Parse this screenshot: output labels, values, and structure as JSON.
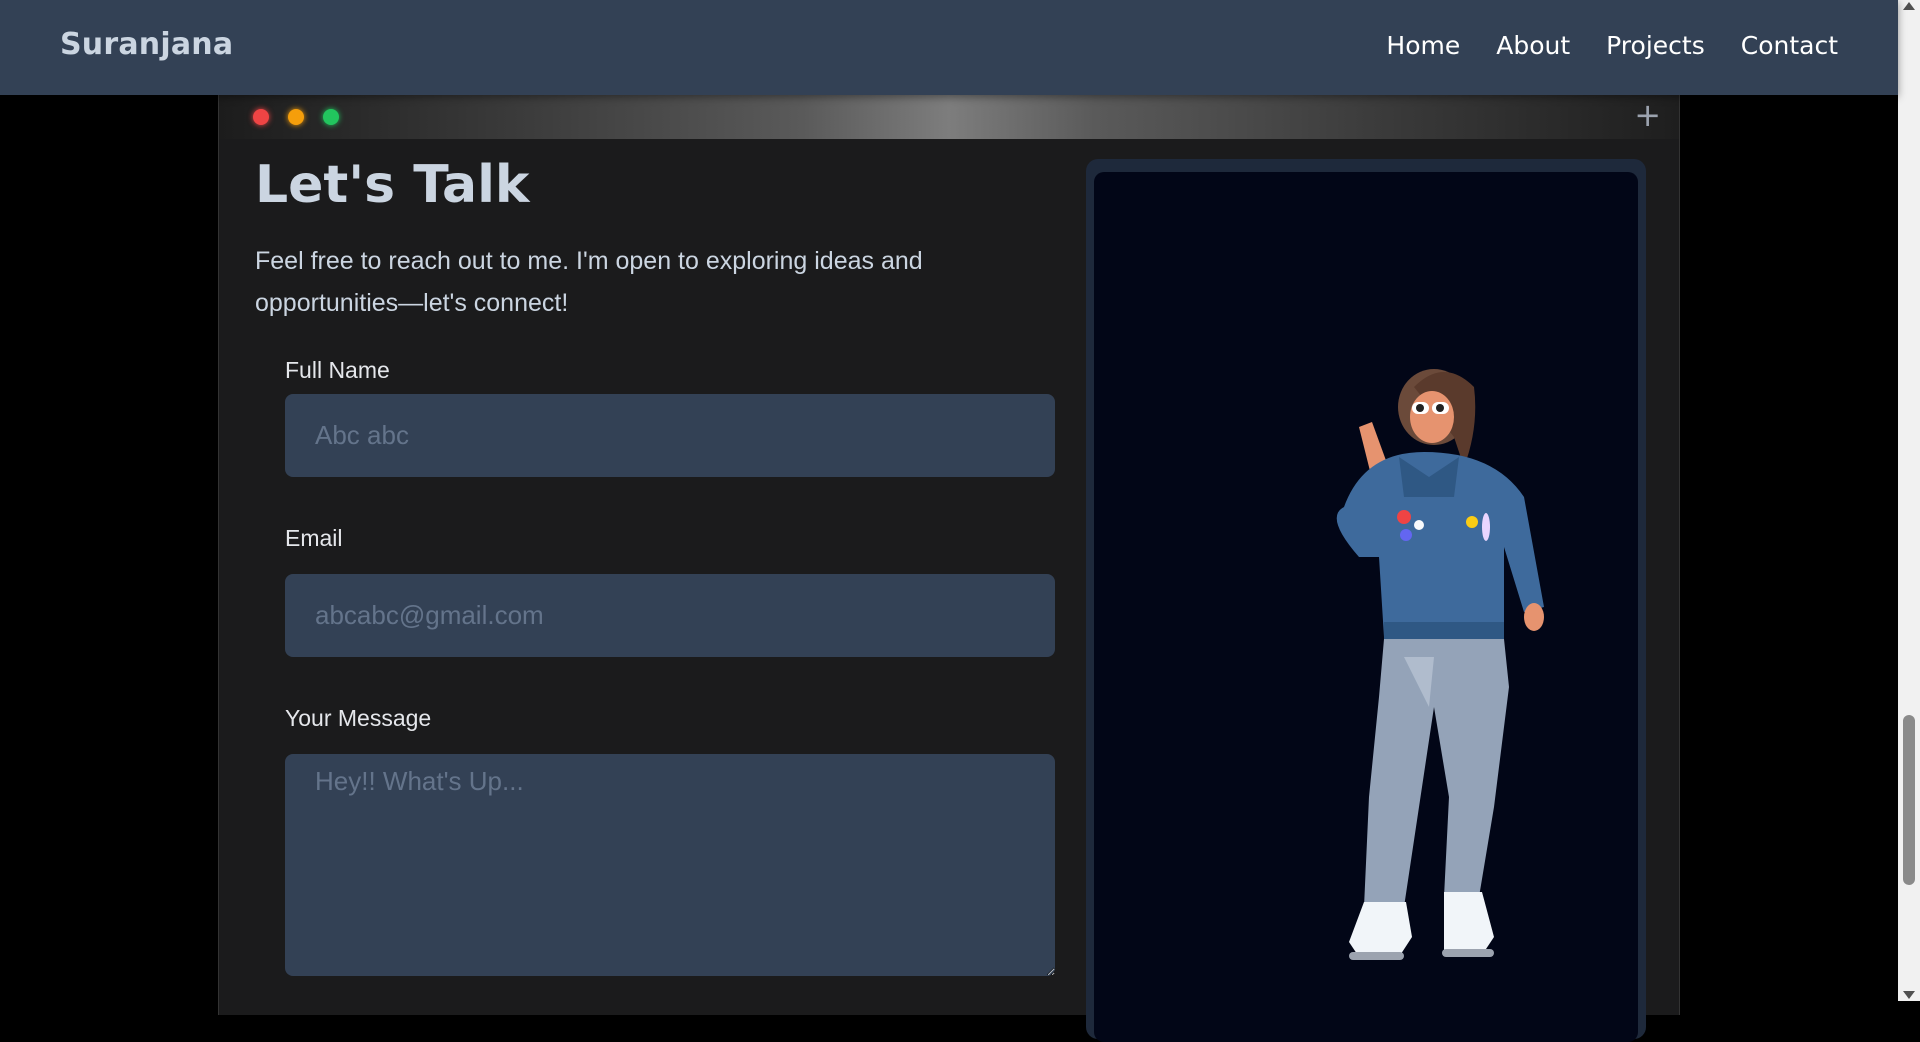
{
  "nav": {
    "brand": "Suranjana",
    "links": [
      "Home",
      "About",
      "Projects",
      "Contact"
    ]
  },
  "window": {
    "plus_symbol": "+"
  },
  "contact": {
    "heading": "Let's Talk",
    "subtitle": "Feel free to reach out to me. I'm open to exploring ideas and opportunities—let's connect!",
    "fields": {
      "name": {
        "label": "Full Name",
        "placeholder": "Abc abc"
      },
      "email": {
        "label": "Email",
        "placeholder": "abcabc@gmail.com"
      },
      "message": {
        "label": "Your Message",
        "placeholder": "Hey!! What's Up..."
      }
    }
  },
  "icons": {
    "window_controls": [
      "close-dot",
      "minimize-dot",
      "maximize-dot"
    ],
    "new_tab": "plus-icon",
    "avatar": "3d-character-avatar"
  },
  "colors": {
    "navbar": "#334155",
    "input_background": "#334155",
    "page_background": "#000000",
    "panel_background": "#020617",
    "dot_red": "#ef4444",
    "dot_yellow": "#f59e0b",
    "dot_green": "#22c55e"
  }
}
